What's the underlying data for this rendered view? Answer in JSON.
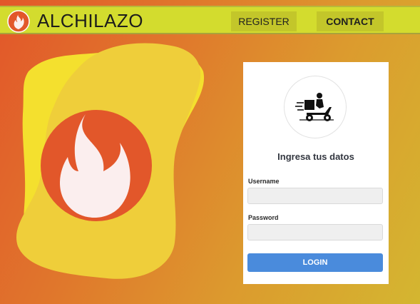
{
  "nav": {
    "brand": "ALCHILAZO",
    "register_label": "REGISTER",
    "contact_label": "CONTACT",
    "logo_icon": "flame-icon"
  },
  "hero": {
    "illustration_icon": "flame-icon"
  },
  "login_card": {
    "avatar_icon": "delivery-scooter-icon",
    "title": "Ingresa tus datos",
    "username_label": "Username",
    "username_value": "",
    "password_label": "Password",
    "password_value": "",
    "login_label": "LOGIN"
  },
  "colors": {
    "navbar": "#d3dc2e",
    "nav_button": "#c3c62a",
    "flame_circle": "#e2572a",
    "flame": "#fbeeee",
    "login_button": "#4a8bdc"
  }
}
